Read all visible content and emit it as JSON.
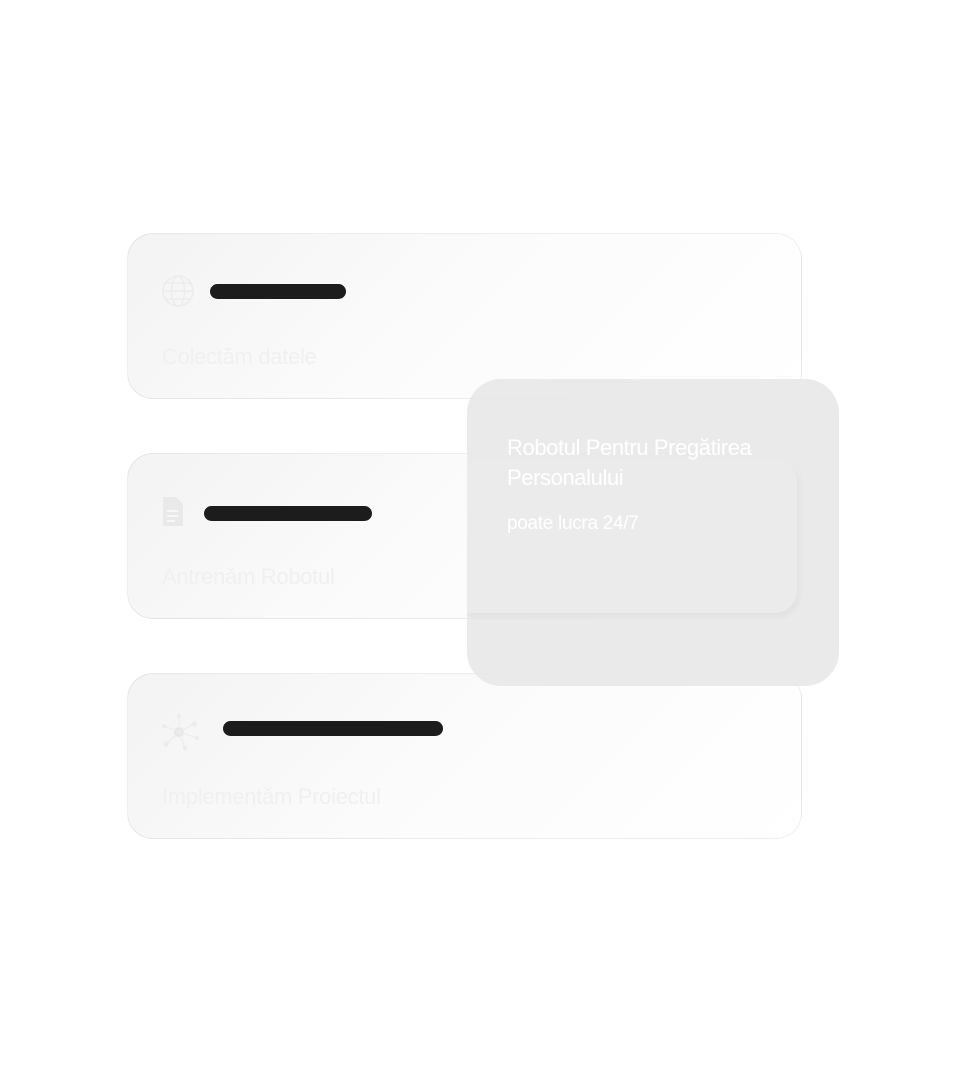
{
  "steps": [
    {
      "text": "Colectăm datele",
      "icon": "globe-icon"
    },
    {
      "text": "Antrenăm Robotul",
      "icon": "document-icon"
    },
    {
      "text": "Implementăm Proiectul",
      "icon": "network-icon"
    }
  ],
  "overlay": {
    "title": "Robotul Pentru Pregătirea Personalului",
    "subtitle": "poate lucra 24/7"
  },
  "colors": {
    "redaction": "#1c1c1c",
    "card_border": "#efefef",
    "overlay_bg": "#e6e6e6"
  }
}
